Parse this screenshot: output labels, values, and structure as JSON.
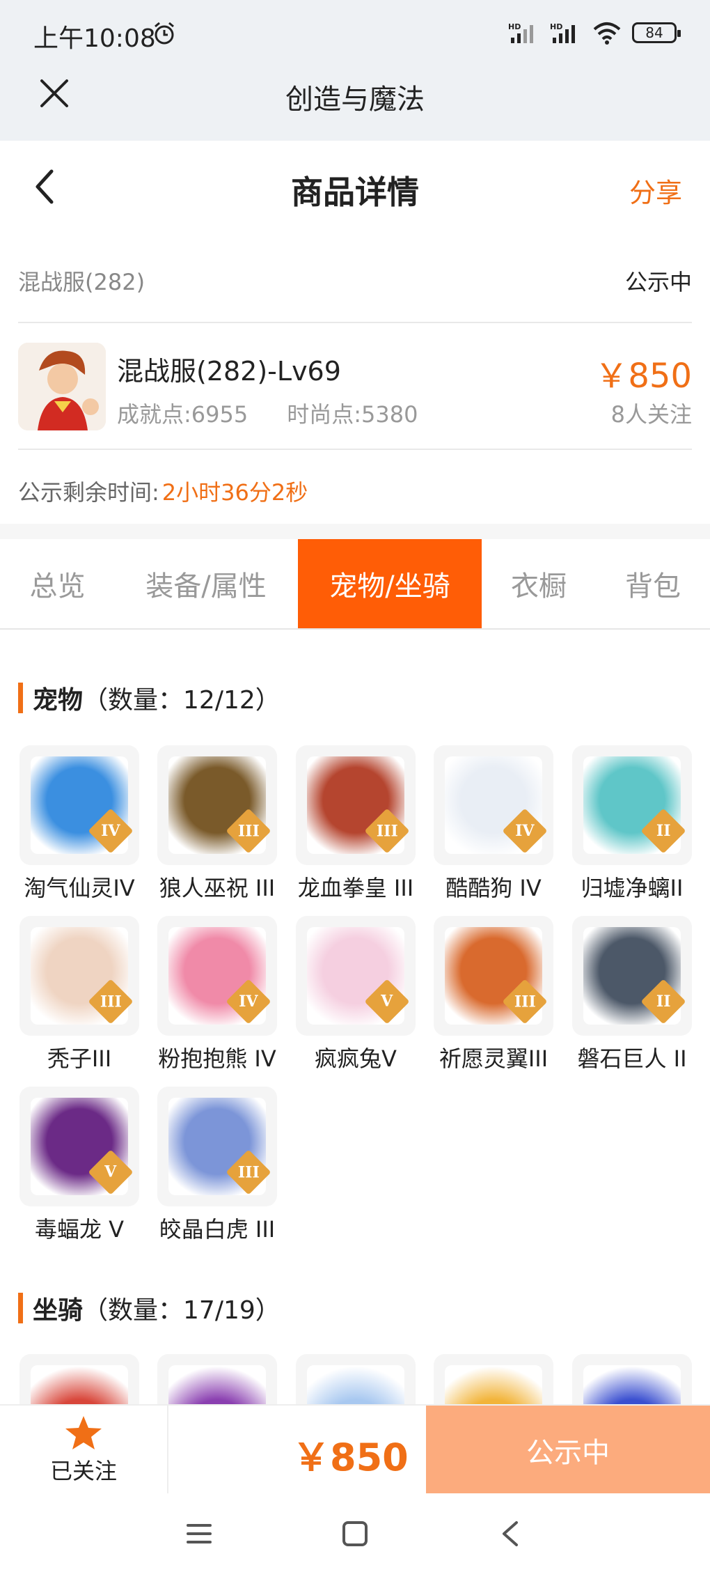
{
  "status_bar": {
    "time": "上午10:08",
    "battery": "84",
    "signal1": "HD",
    "signal2": "HD"
  },
  "app_header": {
    "title": "创造与魔法"
  },
  "page_header": {
    "title": "商品详情",
    "share": "分享"
  },
  "server": {
    "name": "混战服(282)",
    "status": "公示中"
  },
  "product": {
    "name": "混战服(282)-Lv69",
    "achievement": "成就点:6955",
    "fashion": "时尚点:5380",
    "price": "￥850",
    "followers": "8人关注"
  },
  "remaining": {
    "label": "公示剩余时间:",
    "value": "2小时36分2秒"
  },
  "tabs": [
    {
      "label": "总览",
      "active": false
    },
    {
      "label": "装备/属性",
      "active": false
    },
    {
      "label": "宠物/坐骑",
      "active": true
    },
    {
      "label": "衣橱",
      "active": false
    },
    {
      "label": "背包",
      "active": false
    }
  ],
  "pets": {
    "title": "宠物",
    "count": "（数量：12/12）",
    "items": [
      {
        "name": "淘气仙灵IV",
        "tier": "IV",
        "color": "#3b8fe0"
      },
      {
        "name": "狼人巫祝 III",
        "tier": "III",
        "color": "#7a5a2a"
      },
      {
        "name": "龙血拳皇 III",
        "tier": "III",
        "color": "#b5452f"
      },
      {
        "name": "酷酷狗 IV",
        "tier": "IV",
        "color": "#e9eef5"
      },
      {
        "name": "归墟净螭II",
        "tier": "II",
        "color": "#5fc6c8"
      },
      {
        "name": "秃子III",
        "tier": "III",
        "color": "#efd4c2"
      },
      {
        "name": "粉抱抱熊 IV",
        "tier": "IV",
        "color": "#f08aa8"
      },
      {
        "name": "疯疯兔V",
        "tier": "V",
        "color": "#f5cfe0"
      },
      {
        "name": "祈愿灵翼III",
        "tier": "III",
        "color": "#d96a2e"
      },
      {
        "name": "磐石巨人 II",
        "tier": "II",
        "color": "#4c5868"
      },
      {
        "name": "毒蝠龙 V",
        "tier": "V",
        "color": "#6b2a86"
      },
      {
        "name": "皎晶白虎 III",
        "tier": "III",
        "color": "#7c95d8"
      }
    ]
  },
  "mounts": {
    "title": "坐骑",
    "count": "（数量：17/19）",
    "items": [
      {
        "color": "#d8463a"
      },
      {
        "color": "#8a3fb0"
      },
      {
        "color": "#a8c8f0"
      },
      {
        "color": "#f2b43a"
      },
      {
        "color": "#3a4fd0"
      }
    ]
  },
  "bottom_bar": {
    "follow": "已关注",
    "price": "￥850",
    "status_button": "公示中"
  },
  "colors": {
    "accent": "#f06f16",
    "tab_active": "#ff5d06",
    "status_button": "#fcab7d"
  }
}
